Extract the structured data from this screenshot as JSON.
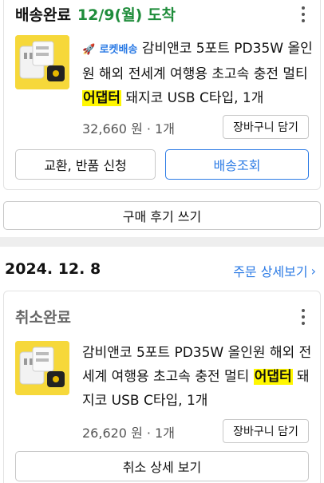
{
  "order1": {
    "status": "배송완료",
    "date_text": "12/9(월) 도착",
    "rocket_badge": "로켓배송",
    "product_line1": "감비앤코 5포트 PD35W 올인",
    "product_line2": "원 해외 전세계 여행용 초고속 충전 멀티",
    "product_highlight": "어댑터",
    "product_line3_rest": " 돼지코 USB C타입, 1개",
    "price": "32,660 원 · 1개",
    "cart_label": "장바구니 담기",
    "exchange_label": "교환, 반품 신청",
    "tracking_label": "배송조회"
  },
  "review_label": "구매 후기 쓰기",
  "order2": {
    "order_date": "2024. 12. 8",
    "detail_link": "주문 상세보기",
    "status": "취소완료",
    "product_line1": "감비앤코 5포트 PD35W 올인원 해외 전",
    "product_line2_pre": "세계 여행용 초고속 충전 멀티 ",
    "product_highlight": "어댑터",
    "product_line2_post": " 돼",
    "product_line3": "지코 USB C타입, 1개",
    "price": "26,620 원 · 1개",
    "cart_label": "장바구니 담기",
    "cancel_detail_label": "취소 상세 보기"
  },
  "icons": {
    "more": "more-vertical-icon",
    "chevron": "chevron-right-icon",
    "rocket": "rocket-icon"
  },
  "colors": {
    "delivered_green": "#1e8c3a",
    "link_blue": "#2c7be5",
    "highlight_yellow": "#fff700",
    "thumb_yellow": "#f6d83a"
  }
}
